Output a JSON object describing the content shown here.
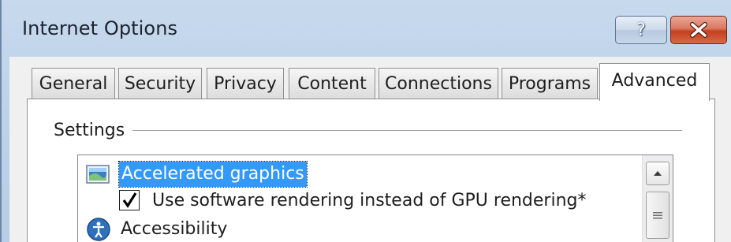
{
  "window": {
    "title": "Internet Options",
    "help_glyph": "?",
    "close_icon": "close-icon"
  },
  "tabs": [
    {
      "label": "General",
      "active": false
    },
    {
      "label": "Security",
      "active": false
    },
    {
      "label": "Privacy",
      "active": false
    },
    {
      "label": "Content",
      "active": false
    },
    {
      "label": "Connections",
      "active": false
    },
    {
      "label": "Programs",
      "active": false
    },
    {
      "label": "Advanced",
      "active": true
    }
  ],
  "settings": {
    "group_label": "Settings",
    "tree": {
      "selected_category": {
        "label": "Accelerated graphics",
        "icon": "monitor-icon"
      },
      "option": {
        "label": "Use software rendering instead of GPU rendering*",
        "checked": true
      },
      "next_category": {
        "label": "Accessibility",
        "icon": "accessibility-icon"
      }
    }
  },
  "colors": {
    "selection": "#3399ff",
    "close_button": "#c2401f",
    "title_bar": "#bed3ea"
  }
}
